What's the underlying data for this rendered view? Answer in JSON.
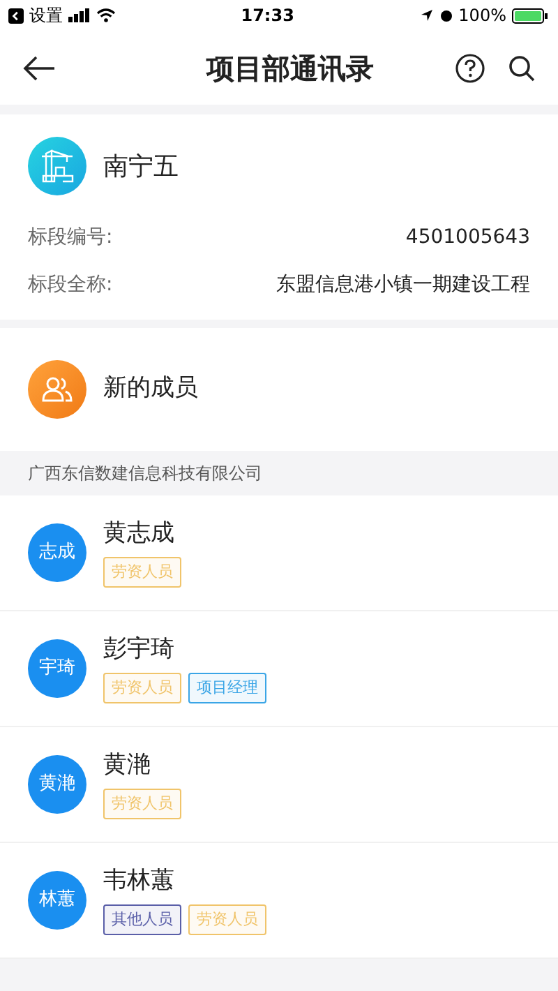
{
  "status_bar": {
    "back_app": "设置",
    "time": "17:33",
    "battery": "100%"
  },
  "nav": {
    "title": "项目部通讯录"
  },
  "project": {
    "name": "南宁五",
    "fields": [
      {
        "label": "标段编号:",
        "value": "4501005643"
      },
      {
        "label": "标段全称:",
        "value": "东盟信息港小镇一期建设工程"
      }
    ]
  },
  "new_members": {
    "label": "新的成员"
  },
  "company": "广西东信数建信息科技有限公司",
  "members": [
    {
      "avatar": "志成",
      "name": "黄志成",
      "tags": [
        {
          "label": "劳资人员",
          "color": "#f0c46a"
        }
      ]
    },
    {
      "avatar": "宇琦",
      "name": "彭宇琦",
      "tags": [
        {
          "label": "劳资人员",
          "color": "#f0c46a"
        },
        {
          "label": "项目经理",
          "color": "#3aa5e6"
        }
      ]
    },
    {
      "avatar": "黄滟",
      "name": "黄滟",
      "tags": [
        {
          "label": "劳资人员",
          "color": "#f0c46a"
        }
      ]
    },
    {
      "avatar": "林蕙",
      "name": "韦林蕙",
      "tags": [
        {
          "label": "其他人员",
          "color": "#5a5fa8"
        },
        {
          "label": "劳资人员",
          "color": "#f0c46a"
        }
      ]
    }
  ]
}
